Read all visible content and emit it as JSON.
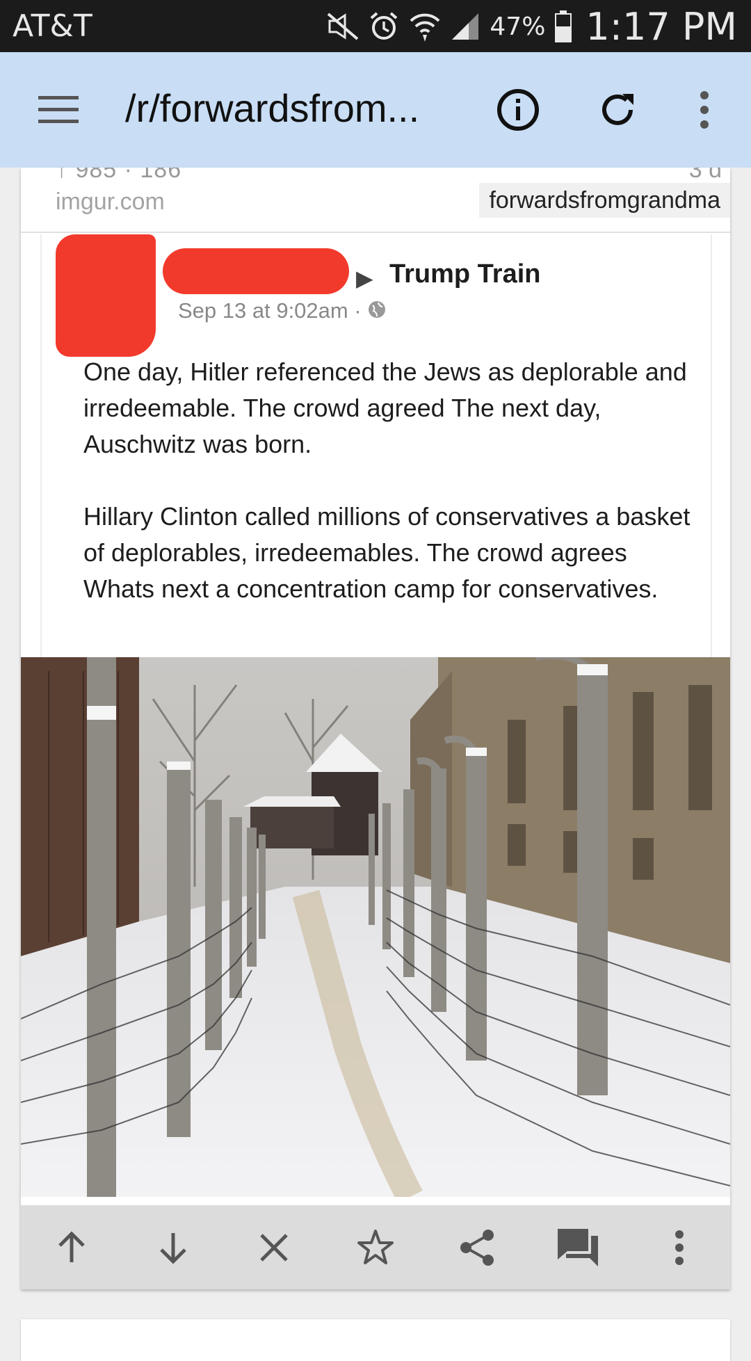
{
  "status_bar": {
    "carrier": "AT&T",
    "battery": "47%",
    "time": "1:17 PM",
    "icons": [
      "mute-icon",
      "alarm-icon",
      "wifi-icon",
      "signal-icon",
      "battery-icon"
    ]
  },
  "toolbar": {
    "title": "/r/forwardsfrom...",
    "icons": [
      "menu-icon",
      "info-icon",
      "refresh-icon",
      "overflow-icon"
    ]
  },
  "post": {
    "domain": "imgur.com",
    "subreddit": "forwardsfromgrandma",
    "score_partial": "↑ 985 · 186",
    "age_partial": "3 d",
    "shot": {
      "group": "Trump Train",
      "timestamp": "Sep 13 at 9:02am · ",
      "paragraph1": "One day,  Hitler referenced the Jews as deplorable and irredeemable. The crowd agreed The next day, Auschwitz was born.",
      "paragraph2": " Hillary Clinton called millions of conservatives a basket of deplorables, irredeemables. The crowd agrees  Whats next a concentration camp for conservatives."
    }
  },
  "actions": [
    "upvote-icon",
    "downvote-icon",
    "hide-icon",
    "save-icon",
    "share-icon",
    "comments-icon",
    "more-icon"
  ],
  "colors": {
    "toolbar_bg": "#c9def5",
    "status_bg": "#1b1b1b",
    "redaction": "#f23a2c",
    "action_bar_bg": "#dcdcdc"
  }
}
